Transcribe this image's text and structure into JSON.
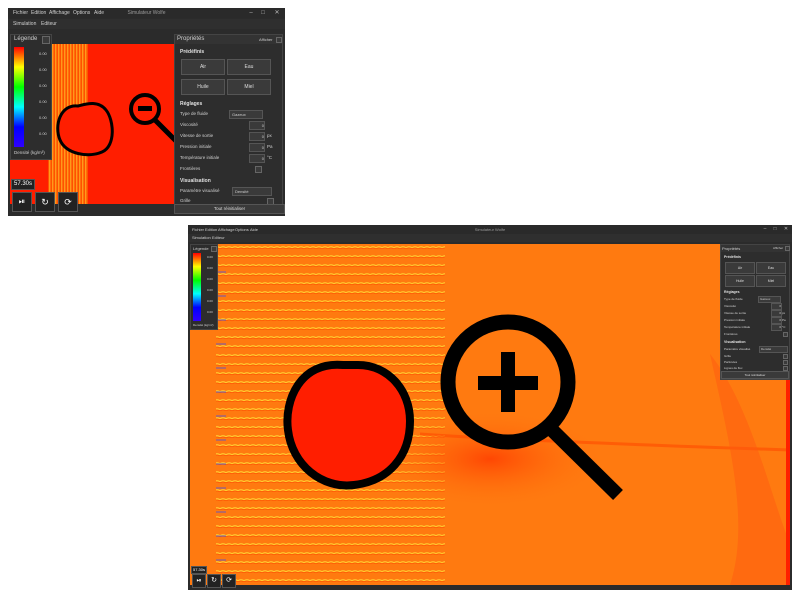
{
  "window": {
    "title": "Simulateur Wolfe",
    "menu": [
      "Fichier",
      "Edition",
      "Affichage",
      "Options",
      "Aide"
    ],
    "tabs": [
      "Simulation",
      "Editeur"
    ]
  },
  "legend": {
    "title": "Légende",
    "ticks": [
      "0.00",
      "0.00",
      "0.00",
      "0.00",
      "0.00",
      "0.00",
      "0.00"
    ],
    "unit": "Densité (kg/m³)"
  },
  "time": "57.30s",
  "properties": {
    "title": "Propriétés",
    "show_label": "Afficher",
    "presets": {
      "title": "Prédéfinis",
      "buttons": [
        "Air",
        "Eau",
        "Huile",
        "Miel"
      ]
    },
    "settings": {
      "title": "Réglages",
      "fluid_type_label": "Type de fluide",
      "fluid_type_value": "Gazeux",
      "viscosity_label": "Viscosité",
      "viscosity_value": "0",
      "exit_speed_label": "Vitesse de sortie",
      "exit_speed_value": "0",
      "exit_speed_unit": "px",
      "initial_pressure_label": "Pression initiale",
      "initial_pressure_value": "0",
      "initial_pressure_unit": "Pa",
      "initial_temp_label": "Température initiale",
      "initial_temp_value": "0",
      "initial_temp_unit": "°C",
      "borders_label": "Frontières"
    },
    "visualisation": {
      "title": "Visualisation",
      "param_label": "Paramètre visualisé",
      "param_value": "Densité",
      "grid_label": "Grille",
      "particles_label": "Particules",
      "streamlines_label": "Lignes de flux"
    },
    "reset_button": "Tout réinitialiser"
  },
  "annotations": {
    "zoom_out": "zoom-out-magnifier-icon",
    "zoom_in": "zoom-in-magnifier-icon",
    "obstacle": "hand-drawn-circle-obstacle"
  },
  "colors": {
    "fluid_bg_small": "#ff1e00",
    "fluid_bg_large": "#ff7a10",
    "window_bg": "#2b2b2b",
    "annotation": "#000000"
  }
}
